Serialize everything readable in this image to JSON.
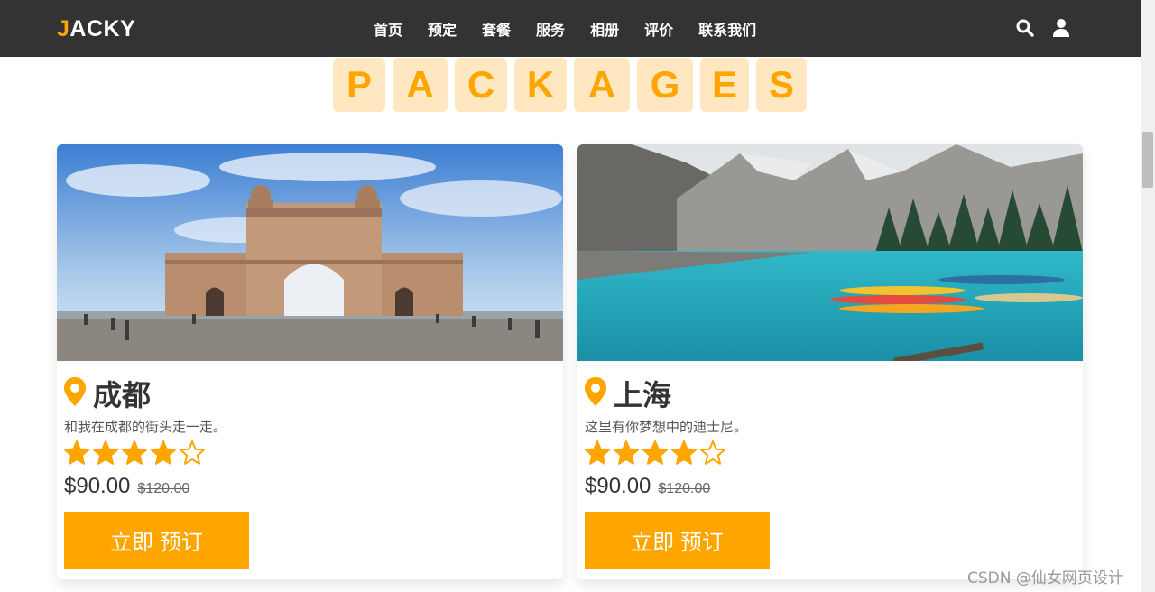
{
  "brand": {
    "logo_first": "J",
    "logo_rest": "ACKY",
    "accent": "#ffa500"
  },
  "nav": {
    "items": [
      "首页",
      "预定",
      "套餐",
      "服务",
      "相册",
      "评价",
      "联系我们"
    ]
  },
  "header_icons": [
    "search-icon",
    "user-icon"
  ],
  "heading": {
    "letters": [
      "P",
      "A",
      "C",
      "K",
      "A",
      "G",
      "E",
      "S"
    ]
  },
  "cards": [
    {
      "city": "成都",
      "description": "和我在成都的街头走一走。",
      "rating": 4,
      "max_rating": 5,
      "price": "$90.00",
      "old_price": "$120.00",
      "button": "立即 预订"
    },
    {
      "city": "上海",
      "description": "这里有你梦想中的迪士尼。",
      "rating": 4,
      "max_rating": 5,
      "price": "$90.00",
      "old_price": "$120.00",
      "button": "立即 预订"
    }
  ],
  "watermark": "CSDN @仙女网页设计"
}
